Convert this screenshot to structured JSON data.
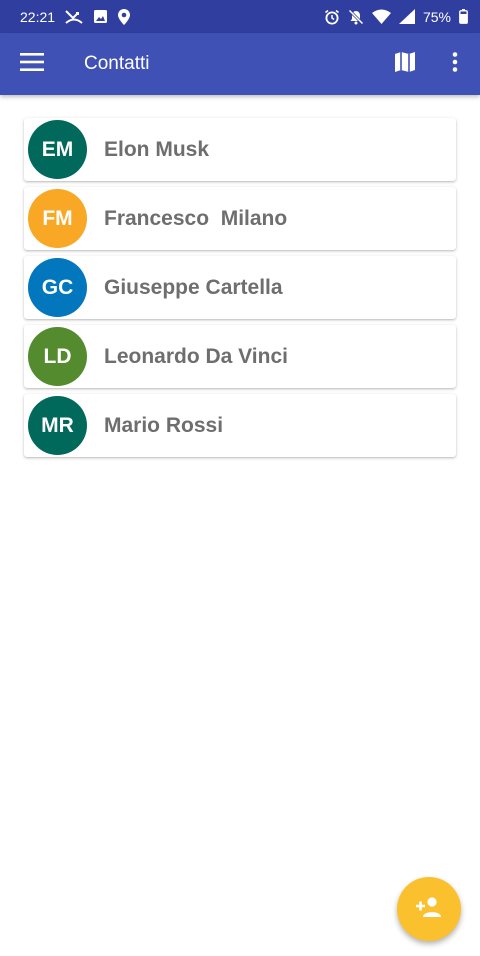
{
  "status_bar": {
    "time": "22:21",
    "battery_percent": "75%",
    "left_icons": [
      "missed-call-icon",
      "image-icon",
      "location-icon"
    ],
    "right_icons": [
      "alarm-icon",
      "notifications-off-icon",
      "wifi-icon",
      "signal-icon",
      "battery-icon"
    ]
  },
  "app_bar": {
    "title": "Contatti",
    "color": "#3f51b5",
    "status_color": "#303f9f",
    "icons": [
      "menu-icon",
      "map-icon",
      "more-vert-icon"
    ]
  },
  "contacts": [
    {
      "initials": "EM",
      "name": "Elon Musk",
      "color": "#00695c"
    },
    {
      "initials": "FM",
      "name": "Francesco  Milano",
      "color": "#f9a825"
    },
    {
      "initials": "GC",
      "name": "Giuseppe Cartella",
      "color": "#0277bd"
    },
    {
      "initials": "LD",
      "name": "Leonardo Da Vinci",
      "color": "#558b2f"
    },
    {
      "initials": "MR",
      "name": "Mario Rossi",
      "color": "#00695c"
    }
  ],
  "fab": {
    "icon": "person-add-icon",
    "color": "#fbc02d"
  }
}
